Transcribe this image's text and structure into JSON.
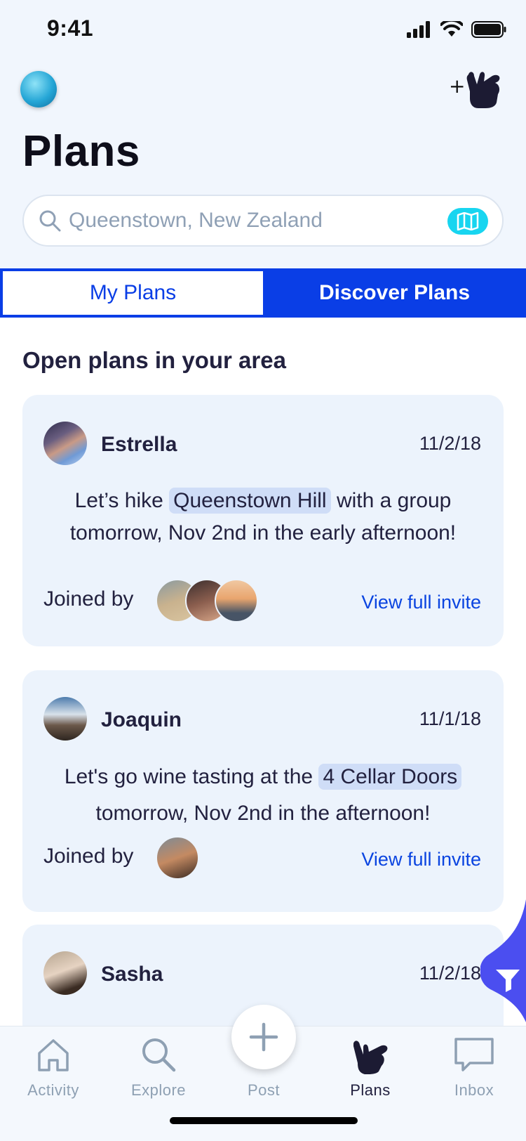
{
  "status_bar": {
    "time": "9:41"
  },
  "header": {
    "title": "Plans"
  },
  "search": {
    "placeholder": "Queenstown, New Zealand"
  },
  "tabs": [
    {
      "label": "My Plans",
      "selected": true
    },
    {
      "label": "Discover Plans",
      "selected": false
    }
  ],
  "section_title": "Open plans in your area",
  "plans": [
    {
      "name": "Estrella",
      "date": "11/2/18",
      "text_before": "Let’s hike",
      "highlight": "Queenstown Hill",
      "text_after": "with a group tomorrow, Nov 2nd in the early afternoon!",
      "joined_label": "Joined by",
      "joined_count": 3,
      "link": "View full invite"
    },
    {
      "name": "Joaquin",
      "date": "11/1/18",
      "text_before": "Let's go wine tasting at the",
      "highlight": "4 Cellar Doors",
      "text_after": "tomorrow, Nov 2nd in the afternoon!",
      "joined_label": "Joined by",
      "joined_count": 1,
      "link": "View full invite"
    },
    {
      "name": "Sasha",
      "date": "11/2/18"
    }
  ],
  "tabbar": [
    {
      "label": "Activity",
      "icon": "home-icon",
      "active": false
    },
    {
      "label": "Explore",
      "icon": "search-icon",
      "active": false
    },
    {
      "label": "Post",
      "icon": "plus-icon",
      "active": false
    },
    {
      "label": "Plans",
      "icon": "shaka-icon",
      "active": true
    },
    {
      "label": "Inbox",
      "icon": "chat-bubble-icon",
      "active": false
    }
  ],
  "colors": {
    "accent": "#0a3ee6",
    "link": "#0a44e0",
    "map_button": "#18d5f0",
    "filter_fab": "#4b4ef0",
    "card_bg": "#ecf3fc",
    "text": "#22213f"
  }
}
